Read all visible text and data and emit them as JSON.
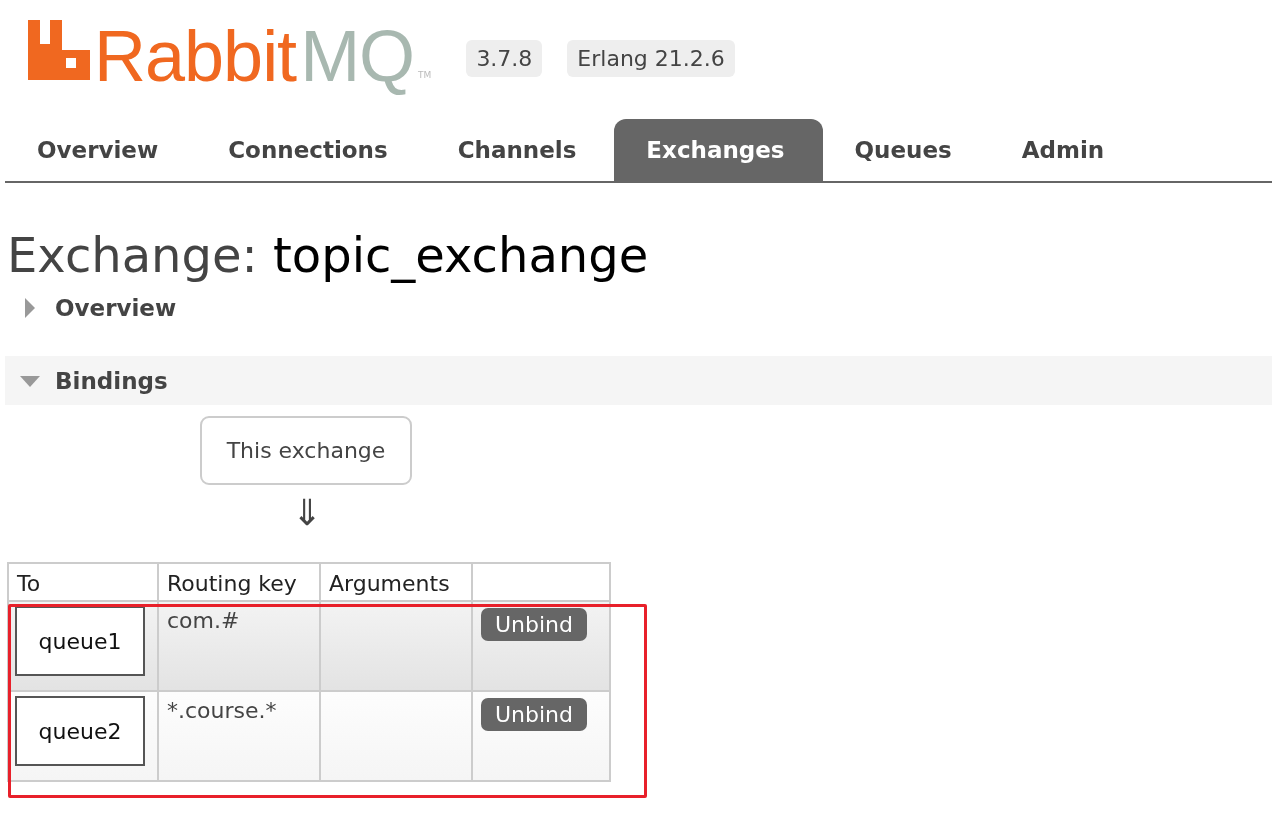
{
  "logo": {
    "word_1": "Rabbit",
    "word_2": "MQ",
    "mark": "TM"
  },
  "badges": [
    "3.7.8",
    "Erlang 21.2.6"
  ],
  "tabs": [
    {
      "label": "Overview",
      "selected": false
    },
    {
      "label": "Connections",
      "selected": false
    },
    {
      "label": "Channels",
      "selected": false
    },
    {
      "label": "Exchanges",
      "selected": true
    },
    {
      "label": "Queues",
      "selected": false
    },
    {
      "label": "Admin",
      "selected": false
    }
  ],
  "heading": {
    "prefix": "Exchange:",
    "name": "topic_exchange"
  },
  "sections": [
    {
      "title": "Overview",
      "expanded": false
    },
    {
      "title": "Bindings",
      "expanded": true
    }
  ],
  "bindings": {
    "source": "This exchange",
    "arrow": "⇓",
    "columns": [
      "To",
      "Routing key",
      "Arguments"
    ],
    "rows": [
      {
        "to": "queue1",
        "routing_key": "com.#",
        "action": "Unbind"
      },
      {
        "to": "queue2",
        "routing_key": "*.course.*",
        "action": "Unbind"
      }
    ],
    "highlighted": true
  }
}
